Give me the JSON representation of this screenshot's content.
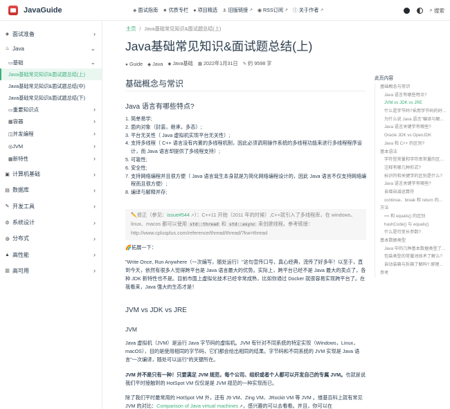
{
  "navbar": {
    "brand": "JavaGuide",
    "links": [
      {
        "icon": "interview-icon",
        "glyph": "◈",
        "label": "面试指南"
      },
      {
        "icon": "star-icon",
        "glyph": "★",
        "label": "优质专栏"
      },
      {
        "icon": "github-icon",
        "glyph": "●",
        "label": "项目精选"
      },
      {
        "icon": "link-icon",
        "glyph": "⚓",
        "label": "旧版链接"
      },
      {
        "icon": "rss-icon",
        "glyph": "◉",
        "label": "RSS订阅"
      },
      {
        "icon": "info-icon",
        "glyph": "ⓘ",
        "label": "关于作者"
      }
    ],
    "external_mark": "↗",
    "search": "搜索"
  },
  "sidebar": {
    "groups": [
      {
        "icon": "interview-icon",
        "glyph": "◈",
        "label": "面试准备"
      },
      {
        "icon": "java-icon",
        "glyph": "♨",
        "label": "Java"
      }
    ],
    "java_sub": [
      {
        "label": "基础",
        "glyph": "▭"
      }
    ],
    "basics_items": [
      "Java基础常见知识&面试题总结(上)",
      "Java基础常见知识&面试题总结(中)",
      "Java基础常见知识&面试题总结(下)"
    ],
    "java_rest": [
      {
        "label": "重要知识点",
        "glyph": "▭"
      },
      {
        "label": "容器",
        "glyph": "▦"
      },
      {
        "label": "并发编程",
        "glyph": "◫"
      },
      {
        "label": "JVM",
        "glyph": "◎"
      },
      {
        "label": "新特性",
        "glyph": "▦"
      }
    ],
    "more_groups": [
      {
        "label": "计算机基础",
        "glyph": "▣"
      },
      {
        "label": "数据库",
        "glyph": "▤"
      },
      {
        "label": "开发工具",
        "glyph": "✎"
      },
      {
        "label": "系统设计",
        "glyph": "⚙"
      },
      {
        "label": "分布式",
        "glyph": "◍"
      },
      {
        "label": "高性能",
        "glyph": "▲"
      },
      {
        "label": "高可用",
        "glyph": "▥"
      }
    ]
  },
  "breadcrumb": {
    "home": "主页",
    "sep": "/",
    "current": "Java基础常见知识&面试题总结(上)"
  },
  "page_title": "Java基础常见知识&面试题总结(上)",
  "meta": {
    "author": "Guide",
    "tag1": "Java",
    "tag2": "Java基础",
    "date": "2022年1月31日",
    "words": "约 9598 字"
  },
  "content": {
    "h2_basics": "基础概念与常识",
    "h3_features": "Java 语言有哪些特点?",
    "features": [
      "1. 简单易学;",
      "2. 面向对象（封装，继承，多态）;",
      "3. 平台无关性（ Java 虚拟机实现平台无关性）;",
      "4. 支持多线程（ C++ 语言没有内置的多线程机制，因此必须调用操作系统的多线程功能来进行多线程程序设计，而 Java 语言却提供了多线程支持）;",
      "5. 可靠性;",
      "6. 安全性;",
      "7. 支持网络编程并且很方便（ Java 语言诞生本身就是为简化网络编程设计的，因此 Java 语言不仅支持网络编程而且很方便）;",
      "8. 编译与解释并存;"
    ],
    "note_prefix": "✏️修正（参见：",
    "note_link": "issue#544",
    "note_mid": "）：C++11 开始（2011 年的时候）,C++就引入了多线程库，在 windows、linux、macos 都可以使用",
    "note_code1": "std::thread",
    "note_and": "和",
    "note_code2": "std::async",
    "note_suffix": "来创建线程。参考链接：http://www.cplusplus.com/reference/thread/thread/?kw=thread",
    "ext_title": "🌈拓展一下：",
    "ext_body": "\"Write Once, Run Anywhere（一次编写，随处运行）\"这句宣传口号，真心经典，流传了好多年！以至于，直到今天，依然有很多人觉得跨平台是 Java 语言最大的优势。实际上，跨平台已经不是 Java 最大的卖点了，各种 JDK 新特性也不是。目前市面上虚拟化技术已经非常成熟，比如你通过 Docker 就很容易实现跨平台了。在我看来，Java 强大的生态才是！",
    "h3_jvm_jdk": "JVM vs JDK vs JRE",
    "h4_jvm": "JVM",
    "jvm_p1": "Java 虚拟机（JVM）是运行 Java 字节码的虚拟机。JVM 有针对不同系统的特定实现（Windows，Linux，macOS），目的是使用相同的字节码，它们都会给出相同的结果。字节码和不同系统的 JVM 实现是 Java 语言\"一次编译，随处可以运行\"的关键所在。",
    "jvm_p2_bold": "JVM 并不是只有一种！只要满足 JVM 规范，每个公司、组织或者个人都可以开发自己的专属 JVM。",
    "jvm_p2_rest": "也就是说我们平时接触到的 HotSpot VM 仅仅是是 JVM 规范的一种实现而已。",
    "jvm_p3": "除了我们平时最常用的 HotSpot VM 外，还有 J9 VM、Zing VM、JRockit VM 等 JVM 。维基百科上就有常见 JVM 的对比：",
    "jvm_p3_link": "Comparison of Java virtual machines",
    "jvm_p3_tail": "，感兴趣的可以去看看。并且，你可以在"
  },
  "toc": {
    "title": "此页内容",
    "items": [
      {
        "label": "基础概念与常识",
        "level": 1
      },
      {
        "label": "Java 语言有哪些特点?",
        "level": 2
      },
      {
        "label": "JVM vs JDK vs JRE",
        "level": 2,
        "active": true
      },
      {
        "label": "什么是字节码?采用字节码的好...",
        "level": 2
      },
      {
        "label": "为什么说 Java 语言\"编译与解...",
        "level": 2
      },
      {
        "label": "Java 语言关键字有哪些?",
        "level": 2
      },
      {
        "label": "Oracle JDK vs OpenJDK",
        "level": 2
      },
      {
        "label": "Java 和 C++ 的区别?",
        "level": 2
      },
      {
        "label": "基本语法",
        "level": 1
      },
      {
        "label": "字符型常量和字符串常量的区别?",
        "level": 2
      },
      {
        "label": "注释有哪几种形式?",
        "level": 2
      },
      {
        "label": "标识符和关键字的区别是什么?",
        "level": 2
      },
      {
        "label": "Java 语言关键字有哪些?",
        "level": 2
      },
      {
        "label": "自增自减运算符",
        "level": 2
      },
      {
        "label": "continue、break 和 return 的...",
        "level": 2
      },
      {
        "label": "方法",
        "level": 1
      },
      {
        "label": "== 和 equals() 的区别",
        "level": 2
      },
      {
        "label": "hashCode() 与 equals()",
        "level": 2
      },
      {
        "label": "什么是可变长参数?",
        "level": 2
      },
      {
        "label": "基本数据类型",
        "level": 1
      },
      {
        "label": "Java 中的几种基本数据类型了...",
        "level": 2
      },
      {
        "label": "包装类型的常量池技术了解么?",
        "level": 2
      },
      {
        "label": "自动装箱与拆箱了解吗? 原理...",
        "level": 2
      },
      {
        "label": "参考",
        "level": 1
      }
    ]
  }
}
